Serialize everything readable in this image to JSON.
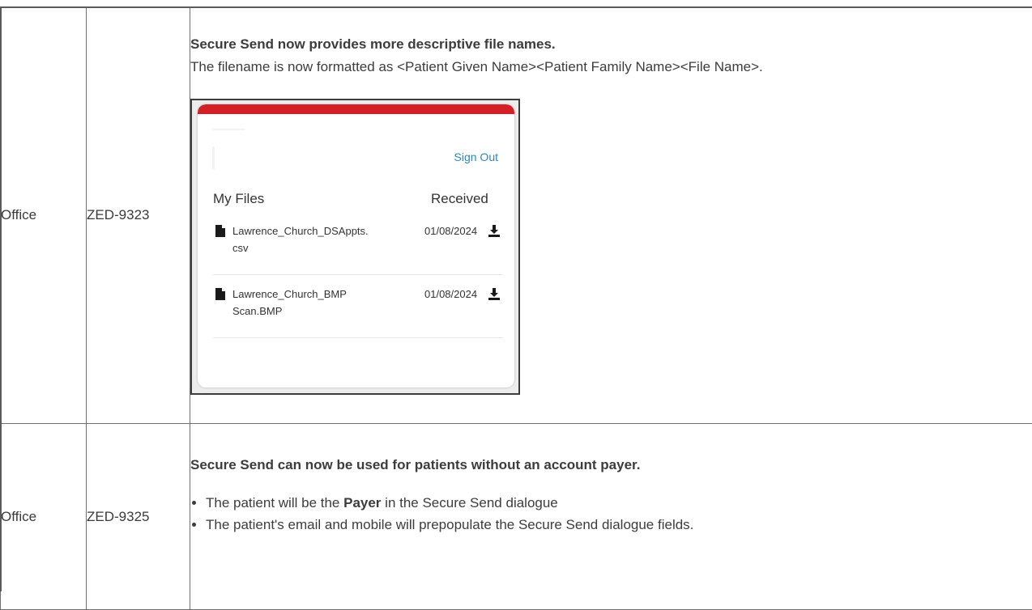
{
  "rows": [
    {
      "product": "Office",
      "id": "ZED-9323",
      "heading": "Secure Send now provides more descriptive file names.",
      "body": "The filename is now formatted as <Patient Given Name><Patient Family Name><File Name>.",
      "screenshot": {
        "sign_out": "Sign Out",
        "col_files": "My Files",
        "col_received": "Received",
        "files": [
          {
            "name_line1": "Lawrence_Church_DSAppts.",
            "name_line2": "csv",
            "date": "01/08/2024"
          },
          {
            "name_line1": "Lawrence_Church_BMP",
            "name_line2": "Scan.BMP",
            "date": "01/08/2024"
          }
        ],
        "accent_color": "#d41f27",
        "link_color": "#2f86b7"
      }
    },
    {
      "product": "Office",
      "id": "ZED-9325",
      "heading": "Secure Send can now be used for patients without an account payer.",
      "bullets": [
        {
          "pre": "The patient will be the ",
          "bold": "Payer",
          "post": " in the Secure Send dialogue"
        },
        {
          "text": "The patient's email and mobile will prepopulate the Secure Send dialogue fields."
        }
      ]
    }
  ]
}
